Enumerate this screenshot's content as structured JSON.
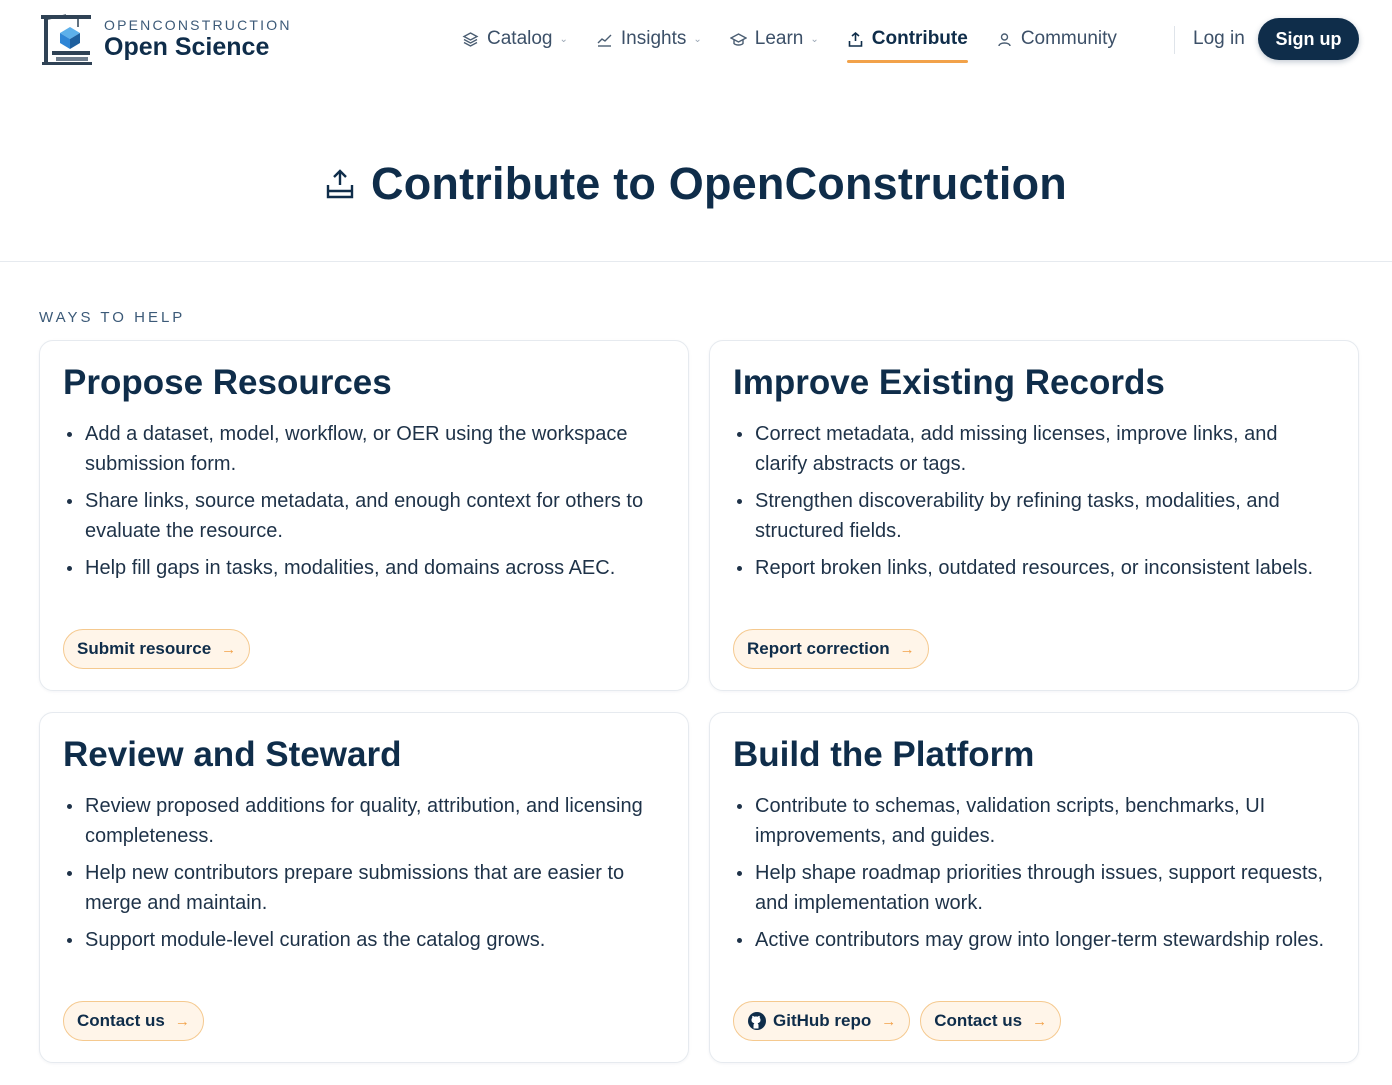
{
  "brand": {
    "top": "OPENCONSTRUCTION",
    "bottom": "Open Science"
  },
  "nav": {
    "items": [
      {
        "label": "Catalog",
        "icon": "layers-icon",
        "dropdown": true
      },
      {
        "label": "Insights",
        "icon": "trend-icon",
        "dropdown": true
      },
      {
        "label": "Learn",
        "icon": "graduation-cap-icon",
        "dropdown": true
      },
      {
        "label": "Contribute",
        "icon": "upload-icon",
        "dropdown": false,
        "active": true
      },
      {
        "label": "Community",
        "icon": "user-icon",
        "dropdown": false
      }
    ],
    "login": "Log in",
    "signup": "Sign up"
  },
  "hero": {
    "title": "Contribute to OpenConstruction"
  },
  "section_label": "WAYS TO HELP",
  "cards": [
    {
      "title": "Propose Resources",
      "bullets": [
        "Add a dataset, model, workflow, or OER using the workspace submission form.",
        "Share links, source metadata, and enough context for others to evaluate the resource.",
        "Help fill gaps in tasks, modalities, and domains across AEC."
      ],
      "buttons": [
        {
          "label": "Submit resource",
          "arrow": "→"
        }
      ]
    },
    {
      "title": "Improve Existing Records",
      "bullets": [
        "Correct metadata, add missing licenses, improve links, and clarify abstracts or tags.",
        "Strengthen discoverability by refining tasks, modalities, and structured fields.",
        "Report broken links, outdated resources, or inconsistent labels."
      ],
      "buttons": [
        {
          "label": "Report correction",
          "arrow": "→"
        }
      ]
    },
    {
      "title": "Review and Steward",
      "bullets": [
        "Review proposed additions for quality, attribution, and licensing completeness.",
        "Help new contributors prepare submissions that are easier to merge and maintain.",
        "Support module-level curation as the catalog grows."
      ],
      "buttons": [
        {
          "label": "Contact us",
          "arrow": "→"
        }
      ]
    },
    {
      "title": "Build the Platform",
      "bullets": [
        "Contribute to schemas, validation scripts, benchmarks, UI improvements, and guides.",
        "Help shape roadmap priorities through issues, support requests, and implementation work.",
        "Active contributors may grow into longer-term stewardship roles."
      ],
      "buttons": [
        {
          "label": "GitHub repo",
          "arrow": "→",
          "icon": "github-icon"
        },
        {
          "label": "Contact us",
          "arrow": "→"
        }
      ]
    }
  ],
  "colors": {
    "navy": "#0f2d4a",
    "accent": "#f2a24a",
    "pill_bg": "#fff5e9"
  }
}
